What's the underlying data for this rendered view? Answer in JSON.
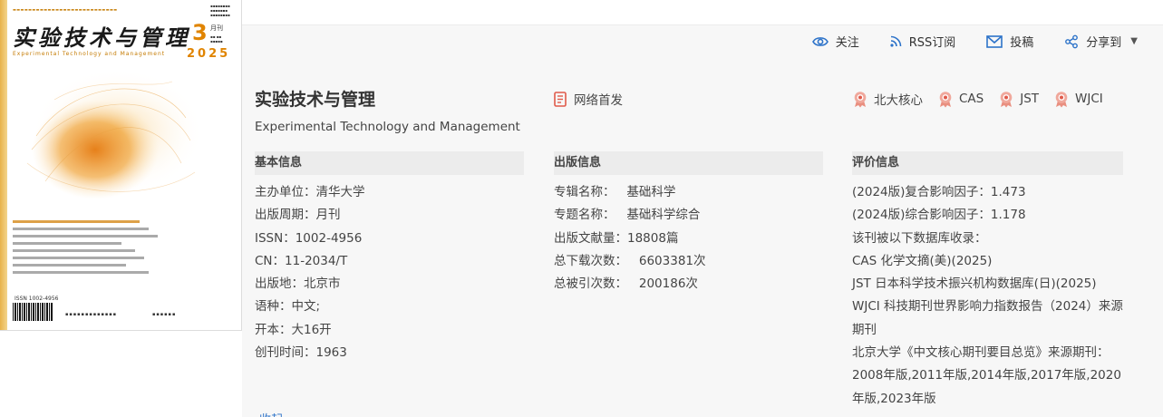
{
  "toolbar": {
    "follow": "关注",
    "rss": "RSS订阅",
    "submit": "投稿",
    "share": "分享到"
  },
  "cover": {
    "title_cn": "实验技术与管理",
    "issue_no": "3",
    "month_label": "月刊",
    "year": "2025",
    "title_en": "Experimental  Technology  and  Management",
    "issn_line": "ISSN 1002-4956"
  },
  "journal": {
    "title": "实验技术与管理",
    "title_en": "Experimental Technology and Management",
    "first_online": "网络首发",
    "badges": [
      "北大核心",
      "CAS",
      "JST",
      "WJCI"
    ]
  },
  "basic": {
    "header": "基本信息",
    "rows": [
      "主办单位：清华大学",
      "出版周期：月刊",
      "ISSN：1002-4956",
      "CN：11-2034/T",
      "出版地：北京市",
      "语种：中文;",
      "开本：大16开",
      "创刊时间：1963"
    ]
  },
  "publish": {
    "header": "出版信息",
    "rows": [
      "专辑名称：   基础科学",
      "专题名称：   基础科学综合",
      "出版文献量：18808篇",
      "总下载次数：   6603381次",
      "总被引次数：   200186次"
    ]
  },
  "evaluation": {
    "header": "评价信息",
    "rows": [
      "(2024版)复合影响因子：1.473",
      "(2024版)综合影响因子：1.178",
      "该刊被以下数据库收录：",
      "CAS 化学文摘(美)(2025)",
      "JST 日本科学技术振兴机构数据库(日)(2025)",
      "WJCI 科技期刊世界影响力指数报告（2024）来源期刊",
      "北京大学《中文核心期刊要目总览》来源期刊：2008年版,2011年版,2014年版,2017年版,2020年版,2023年版"
    ]
  },
  "collapse_label": "收起",
  "colors": {
    "accent_blue": "#2d73c9",
    "badge_red": "#e05a4a",
    "cover_orange": "#e08400"
  },
  "icons": {
    "follow": "eye-icon",
    "rss": "rss-icon",
    "submit": "envelope-icon",
    "share": "share-icon",
    "first_online": "document-icon",
    "badge": "award-ribbon-icon"
  }
}
